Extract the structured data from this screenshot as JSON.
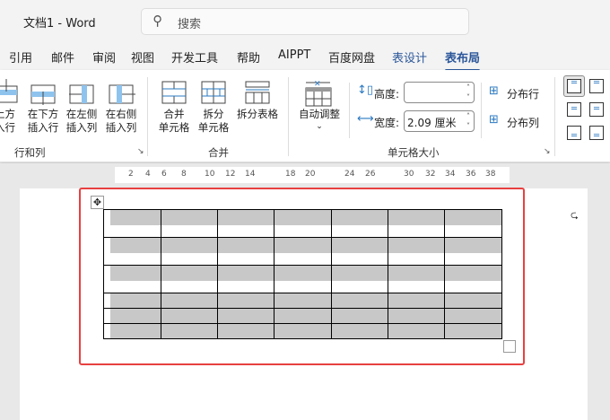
{
  "title": "文档1  -  Word",
  "search": {
    "placeholder": "搜索",
    "icon": "search-icon"
  },
  "tabs": [
    "引用",
    "邮件",
    "审阅",
    "视图",
    "开发工具",
    "帮助",
    "AIPPT",
    "百度网盘",
    "表设计",
    "表布局"
  ],
  "active_tab": "表布局",
  "ribbon": {
    "rows_cols": {
      "buttons": [
        "在上方插入行",
        "在下方插入行",
        "在左侧插入列",
        "在右侧插入列"
      ],
      "b0a": "上方",
      "b0b": "入行",
      "b1a": "在下方",
      "b1b": "插入行",
      "b2a": "在左侧",
      "b2b": "插入列",
      "b3a": "在右侧",
      "b3b": "插入列",
      "label": "行和列"
    },
    "merge": {
      "b0a": "合并",
      "b0b": "单元格",
      "b1a": "拆分",
      "b1b": "单元格",
      "b2": "拆分表格",
      "label": "合并"
    },
    "cell_size": {
      "autofit": "自动调整",
      "height_label": "高度:",
      "height_value": "",
      "width_label": "宽度:",
      "width_value": "2.09 厘米",
      "dist_rows": "分布行",
      "dist_cols": "分布列",
      "label": "单元格大小"
    }
  },
  "ruler": [
    "2",
    "4",
    "6",
    "8",
    "10",
    "12",
    "14",
    "18",
    "20",
    "24",
    "26",
    "30",
    "32",
    "34",
    "36",
    "38"
  ],
  "colors": {
    "accent": "#2b579a",
    "selection": "#e84040",
    "shade": "#c8c8c8"
  }
}
